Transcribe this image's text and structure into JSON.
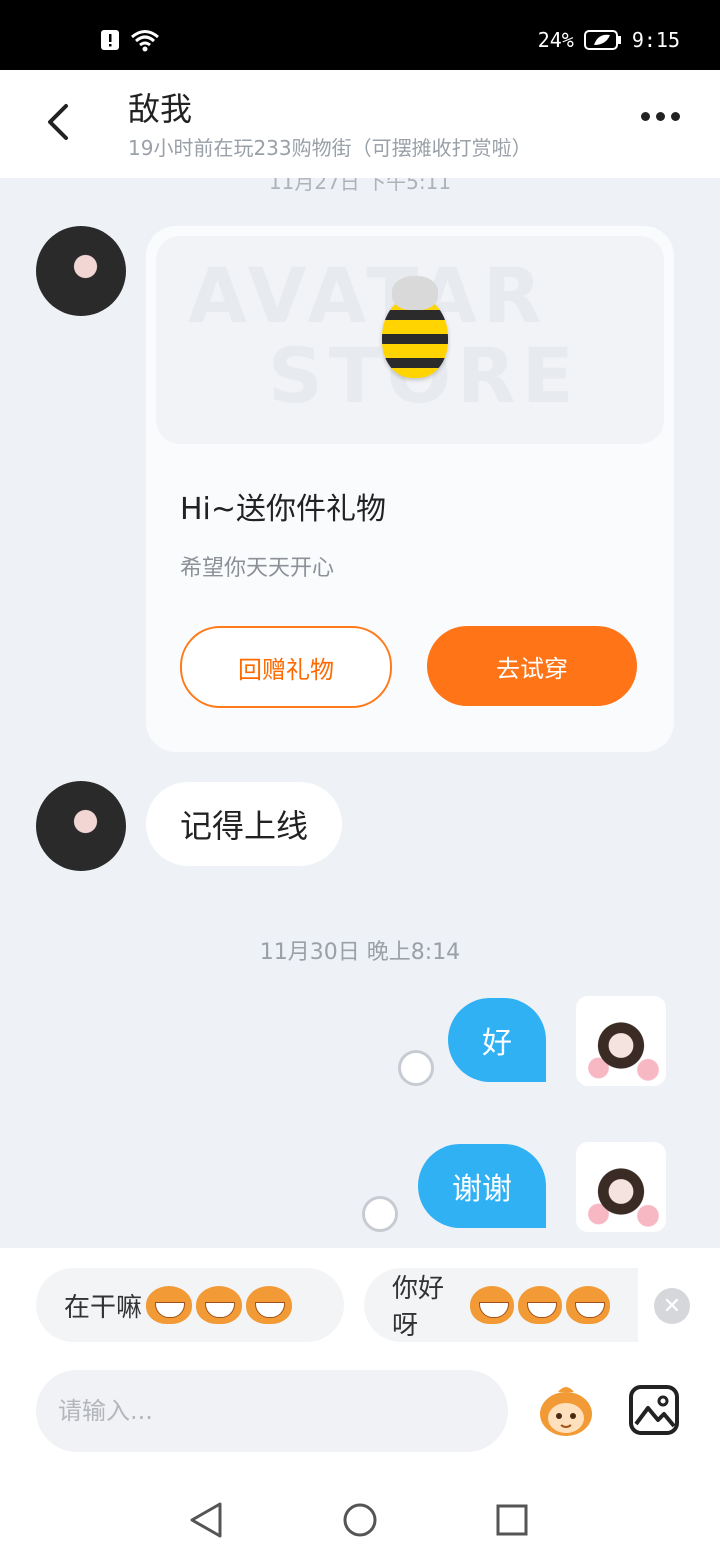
{
  "status_bar": {
    "battery": "24%",
    "time": "9:15"
  },
  "header": {
    "title": "敌我",
    "subtitle": "19小时前在玩233购物街（可摆摊收打赏啦）"
  },
  "chat": {
    "cut_timestamp": "11月27日 下午5:11",
    "gift_card": {
      "banner_line1": "AVATAR",
      "banner_line2": "STORE",
      "title": "Hi~送你件礼物",
      "subtitle": "希望你天天开心",
      "return_gift_label": "回赠礼物",
      "try_on_label": "去试穿"
    },
    "incoming_message": "记得上线",
    "timestamp": "11月30日 晚上8:14",
    "outgoing_messages": [
      "好",
      "谢谢"
    ]
  },
  "quick_replies": [
    {
      "text": "在干嘛"
    },
    {
      "text": "你好呀"
    }
  ],
  "composer": {
    "placeholder": "请输入..."
  },
  "colors": {
    "accent_orange": "#ff7417",
    "bubble_blue": "#2fb1f4"
  }
}
